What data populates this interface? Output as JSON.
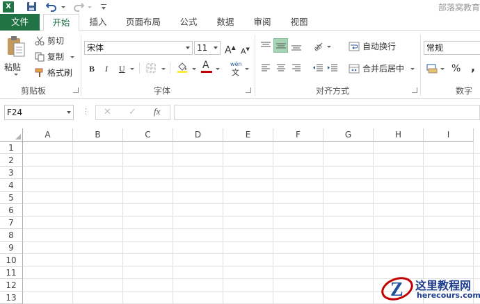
{
  "app": {
    "icon_letter": "X",
    "brand_text": "部落窝教育"
  },
  "tabs": [
    "文件",
    "开始",
    "插入",
    "页面布局",
    "公式",
    "数据",
    "审阅",
    "视图"
  ],
  "ribbon": {
    "clipboard": {
      "paste": "粘贴",
      "cut": "剪切",
      "copy": "复制",
      "format_painter": "格式刷",
      "label": "剪贴板"
    },
    "font": {
      "name": "宋体",
      "size": "11",
      "bold": "B",
      "italic": "I",
      "underline": "U",
      "grow": "A",
      "shrink": "A",
      "font_color_letter": "A",
      "phonetic": "wén",
      "phonetic_char": "文",
      "label": "字体"
    },
    "alignment": {
      "wrap_text": "自动换行",
      "merge_center": "合并后居中",
      "label": "对齐方式"
    },
    "number": {
      "format": "常规",
      "percent": "%",
      "comma": ",",
      "label": "数字"
    }
  },
  "formula_bar": {
    "name_box": "F24",
    "cancel": "✕",
    "enter": "✓",
    "fx": "fx",
    "dots": "⋮",
    "value": ""
  },
  "columns": [
    "A",
    "B",
    "C",
    "D",
    "E",
    "F",
    "G",
    "H",
    "I"
  ],
  "rows": [
    "1",
    "2",
    "3",
    "4",
    "5",
    "6",
    "7",
    "8",
    "9",
    "10",
    "11",
    "12",
    "13"
  ],
  "watermark": {
    "title": "这里教程网",
    "url": "herecours.com"
  },
  "colors": {
    "excel_green": "#217346",
    "accent_red": "#c00000",
    "highlight_yellow": "#ffeb3b"
  }
}
